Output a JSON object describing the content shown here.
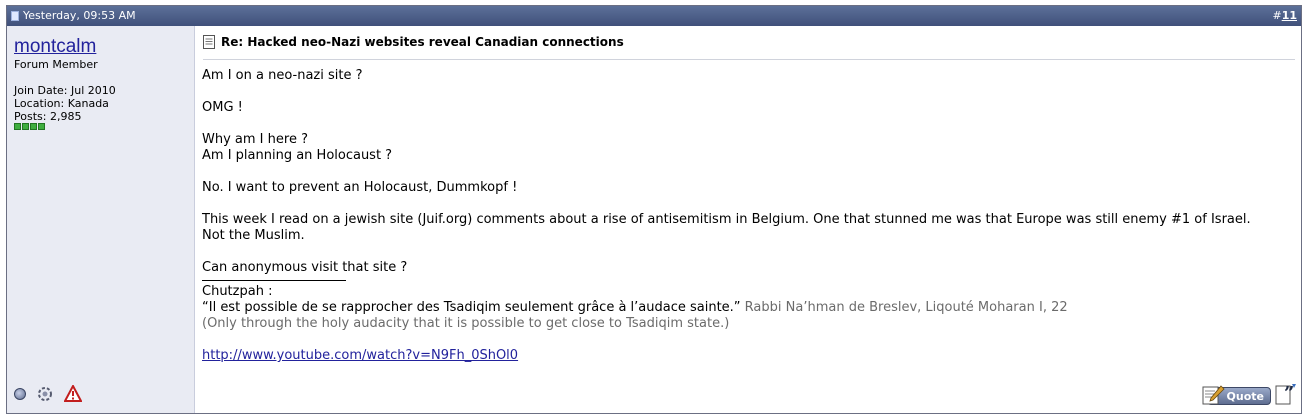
{
  "header": {
    "date": "Yesterday, 09:53 AM",
    "post_hash": "#",
    "post_number": "11"
  },
  "user": {
    "name": "montcalm",
    "rank": "Forum Member",
    "join_date": "Join Date: Jul 2010",
    "location": "Location: Kanada",
    "posts": "Posts: 2,985",
    "reputation_pips": 4
  },
  "post": {
    "title": "Re: Hacked neo-Nazi websites reveal Canadian connections",
    "lines": {
      "l1": "Am I on a neo-nazi site ?",
      "l2": "OMG !",
      "l3": "Why am I here ?",
      "l4": "Am I planning an Holocaust ?",
      "l5": "No. I want to prevent an Holocaust, Dummkopf !",
      "l6": "This week I read on a jewish site (Juif.org) comments about a rise of antisemitism in Belgium. One that stunned me was that Europe was still enemy #1 of Israel.",
      "l7": "Not the Muslim.",
      "l8": "Can anonymous visit that site ?"
    }
  },
  "signature": {
    "heading": "Chutzpah :",
    "quote": "“Il est possible de se rapprocher des Tsadiqim seulement grâce à l’audace sainte.”",
    "attribution": " Rabbi Na’hman de Breslev, Liqouté Moharan I, 22",
    "translation": "(Only through the holy audacity that it is possible to get close to Tsadiqim state.)",
    "link": "http://www.youtube.com/watch?v=N9Fh_0ShOl0"
  },
  "buttons": {
    "quote_label": "Quote"
  },
  "icons": {
    "online": "online-status-icon",
    "reputation": "reputation-icon",
    "report": "report-post-icon",
    "multiquote": "multiquote-icon"
  }
}
